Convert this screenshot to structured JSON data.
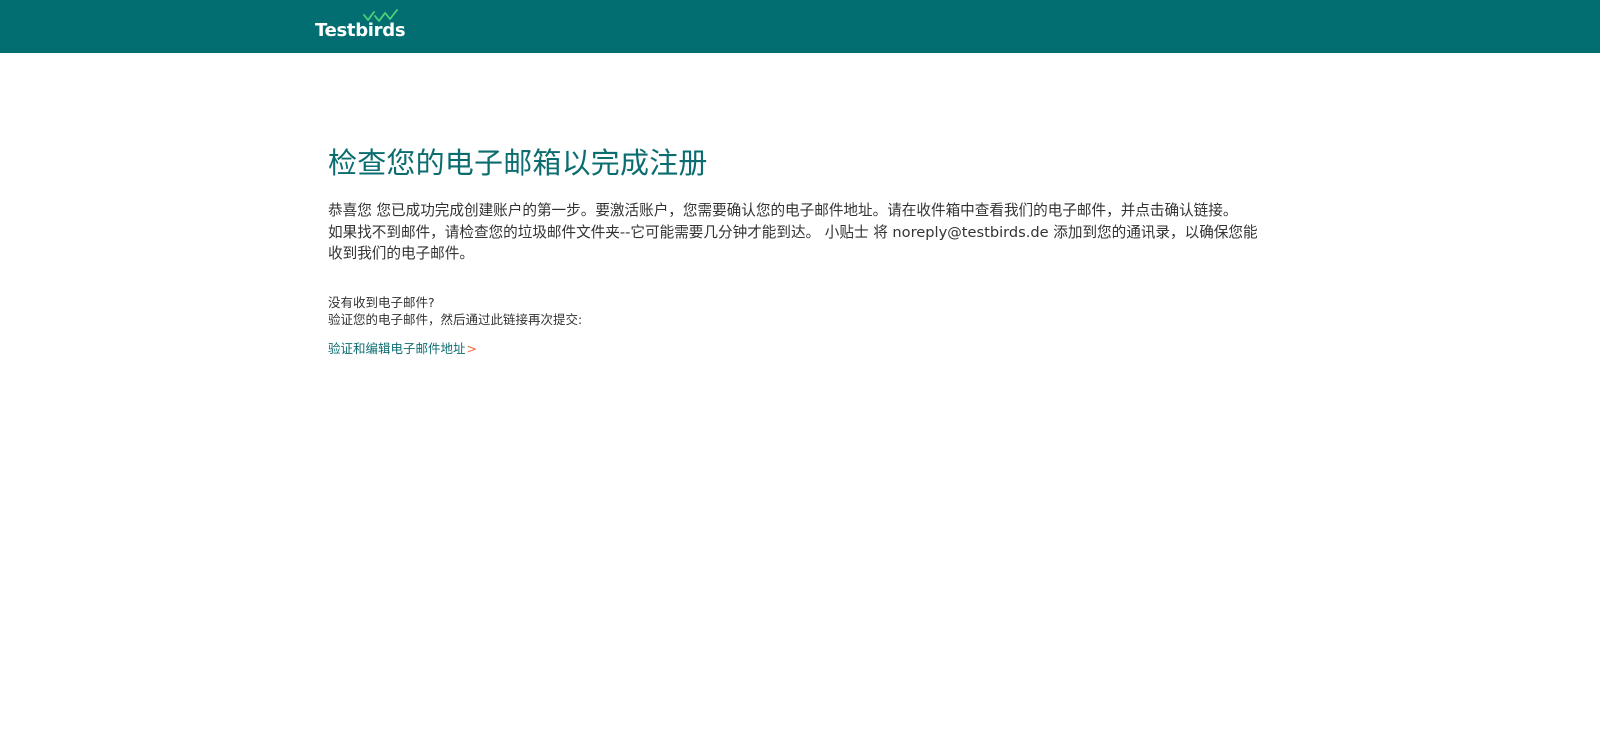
{
  "header": {
    "logo_text": "Testbirds",
    "logo_mark_color": "#4fd17a",
    "background_color": "#026e72"
  },
  "main": {
    "title": "检查您的电子邮箱以完成注册",
    "intro_line_1": "恭喜您 您已成功完成创建账户的第一步。要激活账户，您需要确认您的电子邮件地址。请在收件箱中查看我们的电子邮件，并点击确认链接。",
    "intro_line_2": "如果找不到邮件，请检查您的垃圾邮件文件夹--它可能需要几分钟才能到达。 小贴士 将 noreply@testbirds.de 添加到您的通讯录，以确保您能",
    "intro_line_3": "收到我们的电子邮件。",
    "not_received": "没有收到电子邮件?",
    "verify_instruction": "验证您的电子邮件，然后通过此链接再次提交:",
    "verify_link_label": "验证和编辑电子邮件地址",
    "verify_link_chevron": ">",
    "accent_color": "#0b6d70",
    "chevron_color": "#f0663a"
  }
}
